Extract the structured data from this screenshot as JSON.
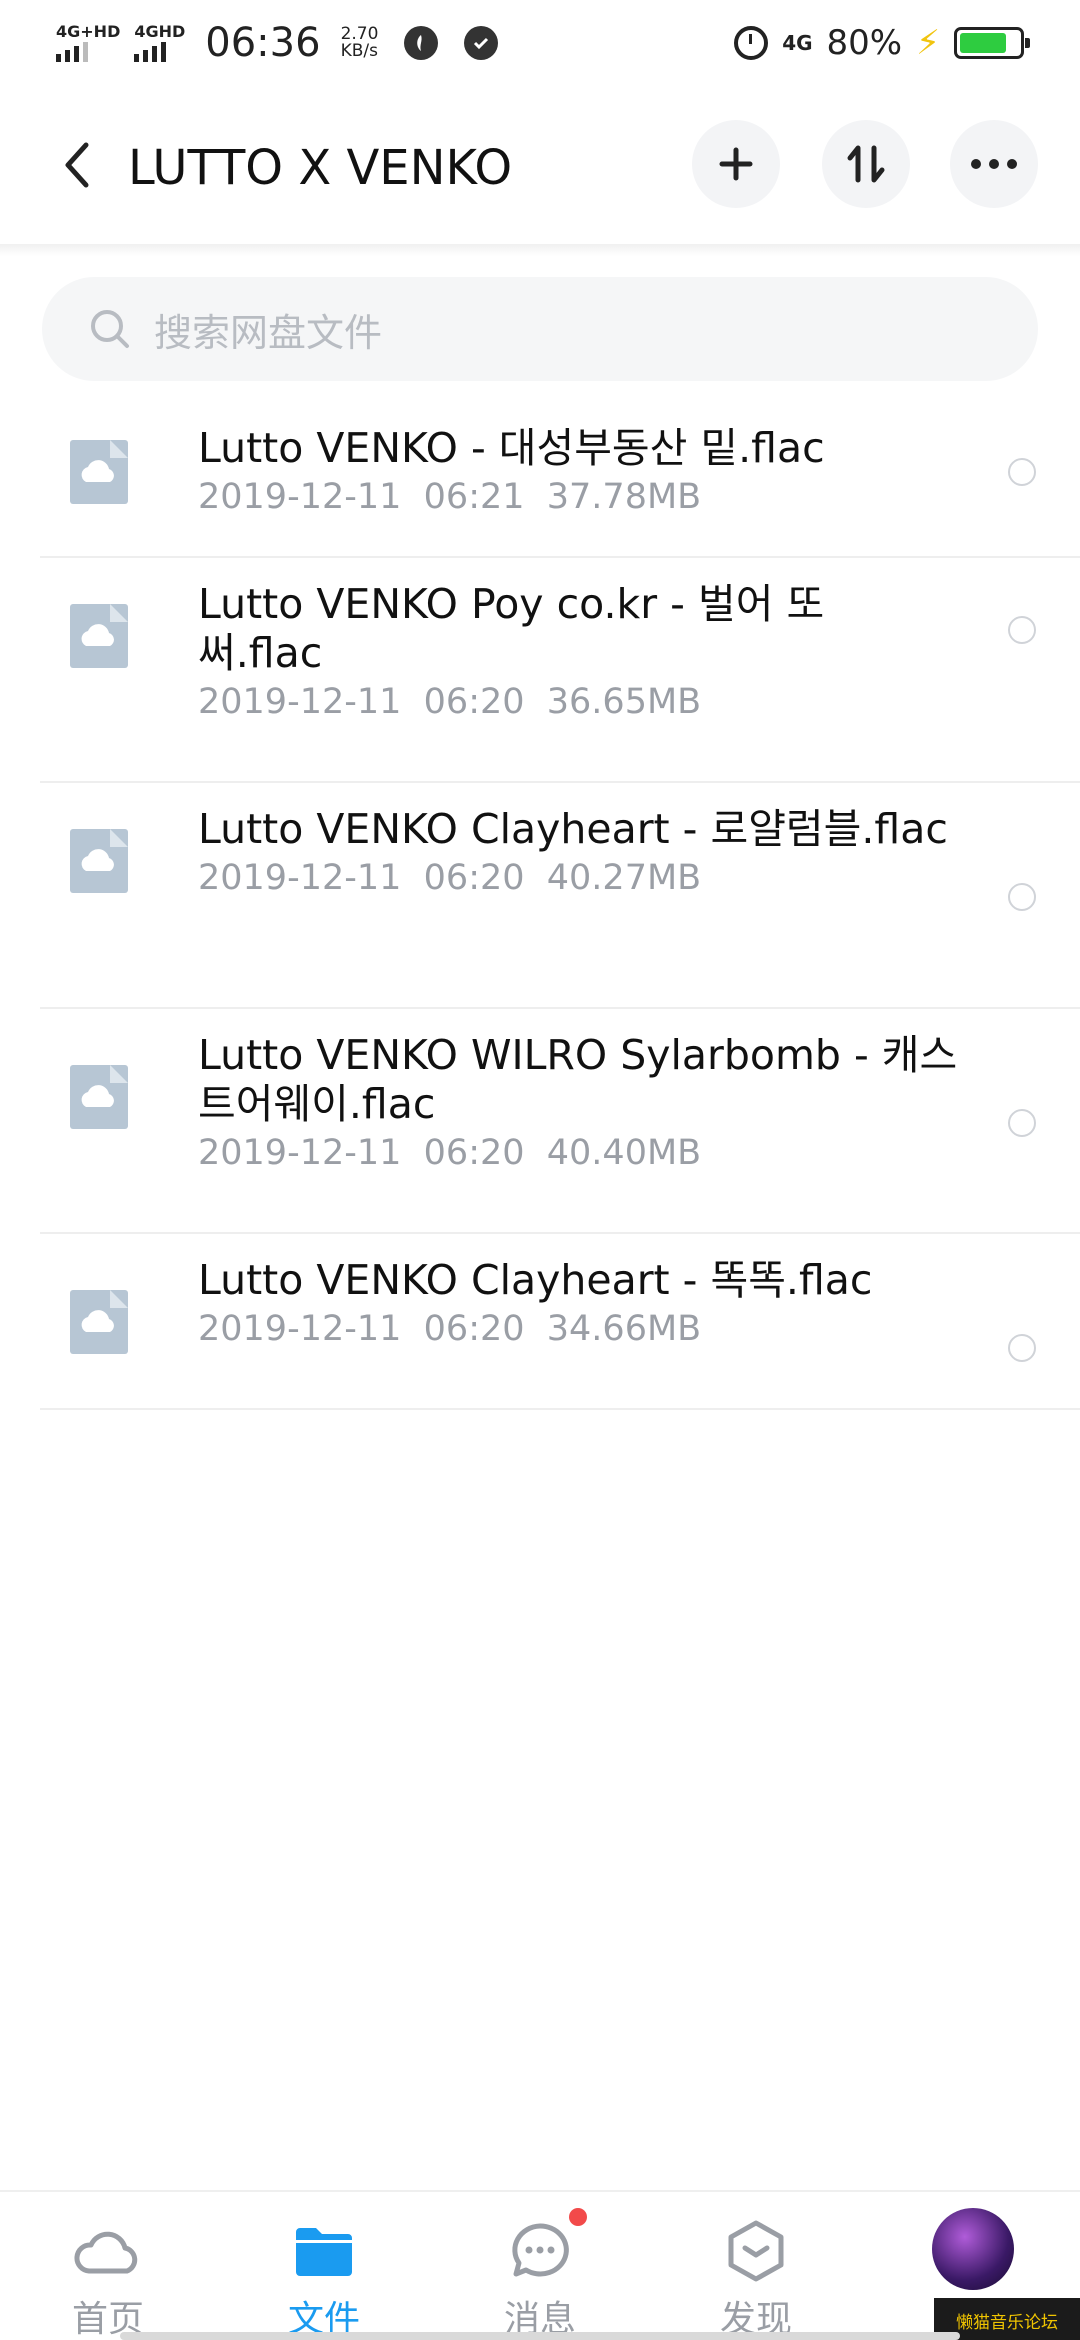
{
  "status_bar": {
    "sim1": "4G+HD",
    "sim2": "4GHD",
    "time": "06:36",
    "speed_value": "2.70",
    "speed_unit": "KB/s",
    "network_right": "4G",
    "battery_percent": "80%",
    "battery_level": 0.8
  },
  "header": {
    "title": "LUTTO X VENKO",
    "back_icon": "back-arrow-icon",
    "actions": [
      "plus-icon",
      "sort-icon",
      "more-icon"
    ]
  },
  "search": {
    "placeholder": "搜索网盘文件"
  },
  "files": [
    {
      "name": "Lutto VENKO - 대성부동산 밑.flac",
      "meta": "2019-12-11  06:21  37.78MB"
    },
    {
      "name": "Lutto VENKO Poy co.kr - 벌어 또 써.flac",
      "meta": "2019-12-11  06:20  36.65MB"
    },
    {
      "name": "Lutto VENKO Clayheart - 로얄럼블.flac",
      "meta": "2019-12-11  06:20  40.27MB"
    },
    {
      "name": "Lutto VENKO WILRO Sylarbomb - 캐스트어웨이.flac",
      "meta": "2019-12-11  06:20  40.40MB"
    },
    {
      "name": "Lutto VENKO Clayheart - 똑똑.flac",
      "meta": "2019-12-11  06:20  34.66MB"
    }
  ],
  "bottom_nav": {
    "items": [
      {
        "label": "首页",
        "icon": "cloud-icon"
      },
      {
        "label": "文件",
        "icon": "folder-icon",
        "active": true
      },
      {
        "label": "消息",
        "icon": "chat-icon",
        "badge": true
      },
      {
        "label": "发现",
        "icon": "discover-icon"
      }
    ]
  },
  "watermark": "懒猫音乐论坛",
  "colors": {
    "accent": "#1a9bf0",
    "badge": "#f24a4a",
    "file_icon": "#b7c6d4",
    "battery": "#2ecc40"
  }
}
